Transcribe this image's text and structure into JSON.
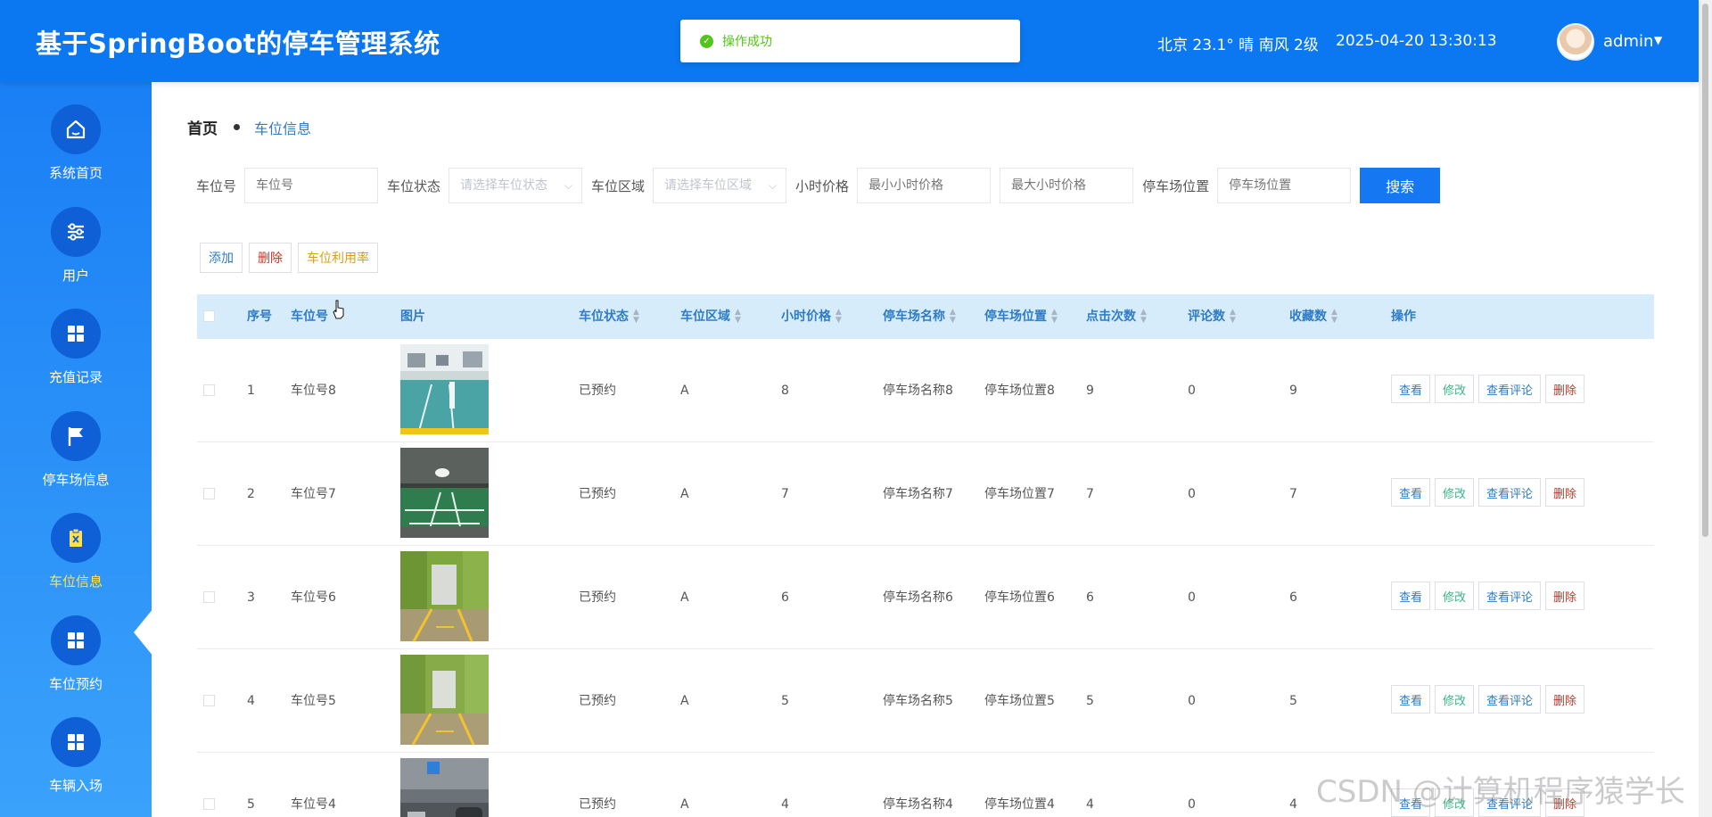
{
  "header": {
    "title": "基于SpringBoot的停车管理系统",
    "toast": "操作成功",
    "weather": "北京 23.1° 晴 南风 2级",
    "datetime": "2025-04-20 13:30:13",
    "user": "admin"
  },
  "sidebar": {
    "items": [
      {
        "label": "系统首页",
        "icon": "home-icon"
      },
      {
        "label": "用户",
        "icon": "sliders-icon"
      },
      {
        "label": "充值记录",
        "icon": "grid-icon"
      },
      {
        "label": "停车场信息",
        "icon": "flag-icon"
      },
      {
        "label": "车位信息",
        "icon": "clipboard-icon",
        "active": true
      },
      {
        "label": "车位预约",
        "icon": "grid-icon"
      },
      {
        "label": "车辆入场",
        "icon": "grid-icon"
      }
    ],
    "active_color": "#ffe14d"
  },
  "breadcrumb": {
    "home": "首页",
    "current": "车位信息"
  },
  "search": {
    "spot_no_label": "车位号",
    "spot_no_placeholder": "车位号",
    "status_label": "车位状态",
    "status_placeholder": "请选择车位状态",
    "area_label": "车位区域",
    "area_placeholder": "请选择车位区域",
    "price_label": "小时价格",
    "price_min_placeholder": "最小小时价格",
    "price_max_placeholder": "最大小时价格",
    "location_label": "停车场位置",
    "location_placeholder": "停车场位置",
    "button": "搜索"
  },
  "actions": {
    "add": "添加",
    "delete": "删除",
    "usage": "车位利用率"
  },
  "table": {
    "columns": [
      "序号",
      "车位号",
      "图片",
      "车位状态",
      "车位区域",
      "小时价格",
      "停车场名称",
      "停车场位置",
      "点击次数",
      "评论数",
      "收藏数",
      "操作"
    ],
    "ops": {
      "view": "查看",
      "edit": "修改",
      "comments": "查看评论",
      "delete": "删除"
    },
    "rows": [
      {
        "index": "1",
        "spot": "车位号8",
        "status": "已预约",
        "area": "A",
        "price": "8",
        "lot_name": "停车场名称8",
        "lot_location": "停车场位置8",
        "clicks": "9",
        "comments": "0",
        "favorites": "9",
        "image": "parking-photo-1"
      },
      {
        "index": "2",
        "spot": "车位号7",
        "status": "已预约",
        "area": "A",
        "price": "7",
        "lot_name": "停车场名称7",
        "lot_location": "停车场位置7",
        "clicks": "7",
        "comments": "0",
        "favorites": "7",
        "image": "parking-photo-2"
      },
      {
        "index": "3",
        "spot": "车位号6",
        "status": "已预约",
        "area": "A",
        "price": "6",
        "lot_name": "停车场名称6",
        "lot_location": "停车场位置6",
        "clicks": "6",
        "comments": "0",
        "favorites": "6",
        "image": "parking-photo-3"
      },
      {
        "index": "4",
        "spot": "车位号5",
        "status": "已预约",
        "area": "A",
        "price": "5",
        "lot_name": "停车场名称5",
        "lot_location": "停车场位置5",
        "clicks": "5",
        "comments": "0",
        "favorites": "5",
        "image": "parking-photo-4"
      },
      {
        "index": "5",
        "spot": "车位号4",
        "status": "已预约",
        "area": "A",
        "price": "4",
        "lot_name": "停车场名称4",
        "lot_location": "停车场位置4",
        "clicks": "4",
        "comments": "0",
        "favorites": "4",
        "image": "parking-photo-5"
      }
    ]
  },
  "watermark": "CSDN @计算机程序猿学长",
  "colors": {
    "header_bg": "#0b78f2",
    "sidebar_top": "#1a7ff5",
    "accent": "#1677f2",
    "link": "#2e7cc6",
    "success": "#52c41a",
    "danger": "#c0392b",
    "edit_green": "#3eb489",
    "usage_gold": "#d4a017"
  }
}
